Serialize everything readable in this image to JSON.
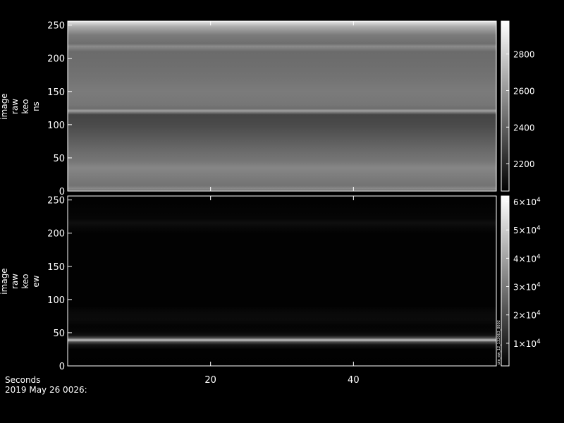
{
  "chart_data": [
    {
      "type": "heatmap",
      "ylabel": [
        "image",
        "raw",
        "keo",
        "ns"
      ],
      "xlim": [
        0,
        60
      ],
      "ylim": [
        0,
        256
      ],
      "y_ticks": [
        0,
        50,
        100,
        150,
        200,
        250
      ],
      "colorbar": {
        "range": [
          2050,
          2980
        ],
        "ticks": [
          {
            "value": 2200,
            "label": "2200"
          },
          {
            "value": 2400,
            "label": "2400"
          },
          {
            "value": 2600,
            "label": "2600"
          },
          {
            "value": 2800,
            "label": "2800"
          }
        ]
      },
      "rows": [
        {
          "y": 0,
          "v": 2340
        },
        {
          "y": 3,
          "v": 2560
        },
        {
          "y": 8,
          "v": 2470
        },
        {
          "y": 20,
          "v": 2500
        },
        {
          "y": 35,
          "v": 2540
        },
        {
          "y": 45,
          "v": 2480
        },
        {
          "y": 60,
          "v": 2440
        },
        {
          "y": 80,
          "v": 2380
        },
        {
          "y": 100,
          "v": 2320
        },
        {
          "y": 115,
          "v": 2300
        },
        {
          "y": 118,
          "v": 2460
        },
        {
          "y": 121,
          "v": 2640
        },
        {
          "y": 124,
          "v": 2450
        },
        {
          "y": 130,
          "v": 2480
        },
        {
          "y": 150,
          "v": 2500
        },
        {
          "y": 170,
          "v": 2470
        },
        {
          "y": 190,
          "v": 2450
        },
        {
          "y": 210,
          "v": 2440
        },
        {
          "y": 218,
          "v": 2560
        },
        {
          "y": 222,
          "v": 2450
        },
        {
          "y": 235,
          "v": 2500
        },
        {
          "y": 248,
          "v": 2680
        },
        {
          "y": 256,
          "v": 2900
        }
      ]
    },
    {
      "type": "heatmap",
      "ylabel": [
        "image",
        "raw",
        "keo",
        "ew"
      ],
      "xlim": [
        0,
        60
      ],
      "ylim": [
        0,
        256
      ],
      "y_ticks": [
        0,
        50,
        100,
        150,
        200,
        250
      ],
      "colorbar": {
        "range": [
          2000,
          62000
        ],
        "ticks": [
          {
            "value": 10000,
            "mantissa": "1",
            "exp": "4"
          },
          {
            "value": 20000,
            "mantissa": "2",
            "exp": "4"
          },
          {
            "value": 30000,
            "mantissa": "3",
            "exp": "4"
          },
          {
            "value": 40000,
            "mantissa": "4",
            "exp": "4"
          },
          {
            "value": 50000,
            "mantissa": "5",
            "exp": "4"
          },
          {
            "value": 60000,
            "mantissa": "6",
            "exp": "4"
          }
        ],
        "note": "pie_ew_12_132063_0002"
      },
      "rows": [
        {
          "y": 0,
          "v": 2200
        },
        {
          "y": 25,
          "v": 2500
        },
        {
          "y": 32,
          "v": 7000
        },
        {
          "y": 36,
          "v": 20000
        },
        {
          "y": 39,
          "v": 48000
        },
        {
          "y": 42,
          "v": 20000
        },
        {
          "y": 46,
          "v": 6000
        },
        {
          "y": 52,
          "v": 3500
        },
        {
          "y": 60,
          "v": 3000
        },
        {
          "y": 70,
          "v": 4500
        },
        {
          "y": 80,
          "v": 4000
        },
        {
          "y": 90,
          "v": 2500
        },
        {
          "y": 200,
          "v": 2400
        },
        {
          "y": 210,
          "v": 4000
        },
        {
          "y": 215,
          "v": 5500
        },
        {
          "y": 222,
          "v": 3500
        },
        {
          "y": 240,
          "v": 2600
        },
        {
          "y": 256,
          "v": 2300
        }
      ]
    }
  ],
  "x_axis": {
    "label": "Seconds",
    "ticks": [
      20,
      40
    ],
    "date_label": "2019 May 26 0026:"
  }
}
